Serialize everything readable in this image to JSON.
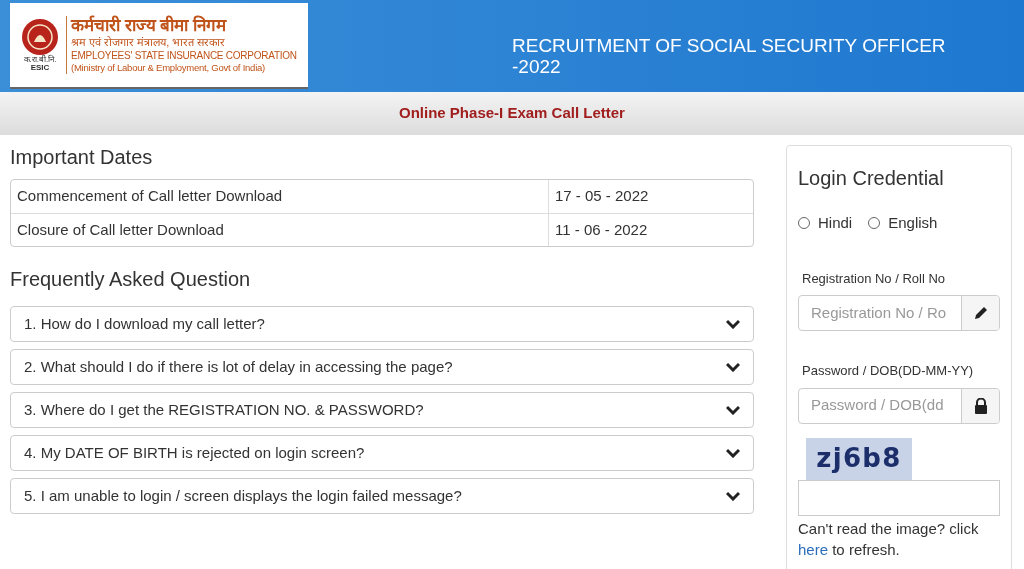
{
  "header": {
    "logo": {
      "hindi_title": "कर्मचारी राज्य बीमा निगम",
      "hindi_subtitle": "श्रम एवं रोजगार मंत्रालय, भारत सरकार",
      "name": "EMPLOYEES' STATE INSURANCE CORPORATION",
      "ministry": "(Ministry of Labour & Employment, Govt of India)",
      "emblem_hindi": "क.रा.बी.नि.",
      "emblem_abbr": "ESIC"
    },
    "title_lines": [
      "RECRUITMENT OF SOCIAL SECURITY OFFICER",
      "-2022"
    ]
  },
  "subheader": "Online Phase-I Exam Call Letter",
  "important_dates": {
    "title": "Important Dates",
    "rows": [
      {
        "label": "Commencement of Call letter Download",
        "date": "17 - 05 - 2022"
      },
      {
        "label": "Closure of Call letter Download",
        "date": "11 - 06 - 2022"
      }
    ]
  },
  "faq": {
    "title": "Frequently Asked Question",
    "items": [
      {
        "question": "1. How do I download my call letter?",
        "expanded": false
      },
      {
        "question": "2. What should I do if there is lot of delay in accessing the page?",
        "expanded": false
      },
      {
        "question": "3. Where do I get the REGISTRATION NO. & PASSWORD?",
        "expanded": false
      },
      {
        "question": "4. My DATE OF BIRTH is rejected on login screen?",
        "expanded": false
      },
      {
        "question": "5. I am unable to login / screen displays the login failed message?",
        "expanded": false
      }
    ]
  },
  "login": {
    "title": "Login Credential",
    "languages": [
      {
        "label": "Hindi",
        "selected": false
      },
      {
        "label": "English",
        "selected": false
      }
    ],
    "fields": [
      {
        "label": "Registration No / Roll No",
        "placeholder": "Registration No / Ro",
        "kind": "edit"
      },
      {
        "label": "Password / DOB(DD-MM-YY)",
        "placeholder": "Password / DOB(dd",
        "kind": "lock"
      }
    ],
    "captcha": "zj6b8",
    "refresh_text": "Can't read the image? click",
    "refresh_link": "here",
    "refresh_suffix": "to refresh."
  }
}
